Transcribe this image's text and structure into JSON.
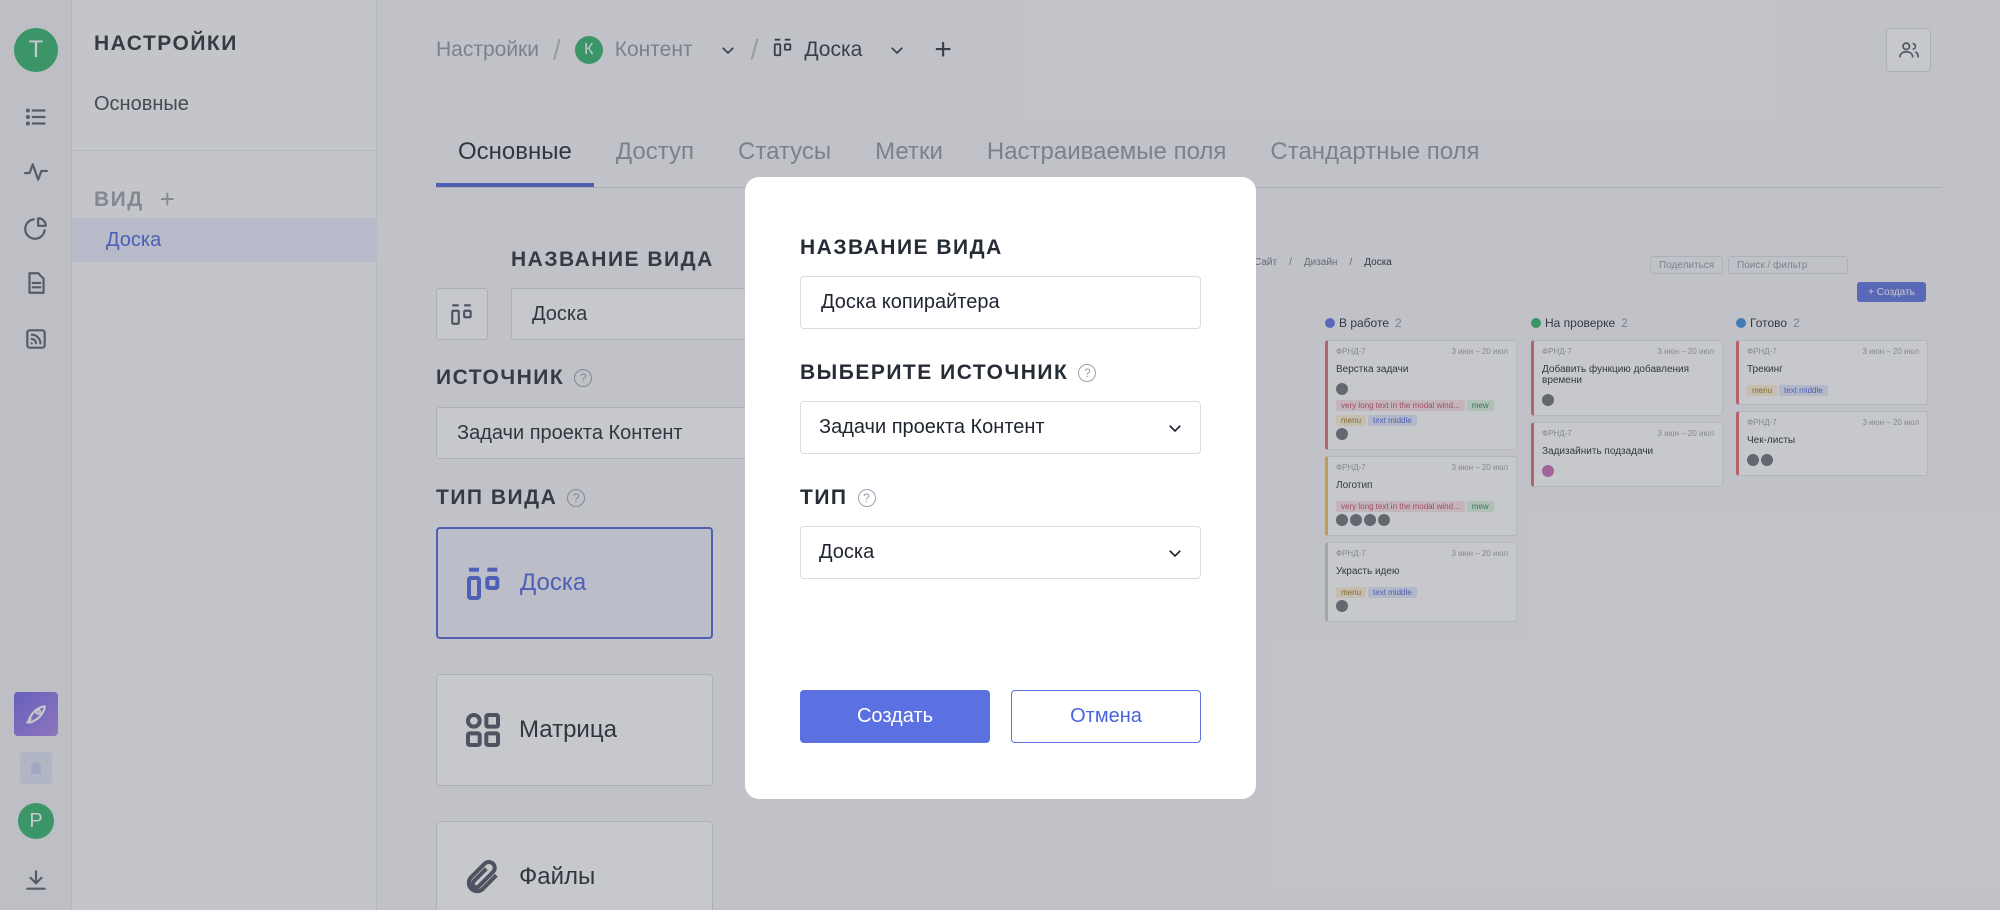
{
  "rail": {
    "user_initial": "T",
    "user_color": "#2fb36e",
    "bottom_initial": "P",
    "bottom_color": "#2fb36e",
    "icons": [
      "list-icon",
      "activity-icon",
      "pie-chart-icon",
      "document-icon",
      "feed-icon",
      "rocket-icon",
      "bell-icon",
      "download-icon"
    ]
  },
  "sidebar": {
    "title": "НАСТРОЙКИ",
    "main_item": "Основные",
    "section_title": "ВИД",
    "items": [
      {
        "label": "Доска"
      }
    ]
  },
  "breadcrumb": {
    "root": "Настройки",
    "project_initial": "К",
    "project": "Контент",
    "view": "Доска"
  },
  "tabs": [
    {
      "label": "Основные",
      "active": true
    },
    {
      "label": "Доступ"
    },
    {
      "label": "Статусы"
    },
    {
      "label": "Метки"
    },
    {
      "label": "Настраиваемые поля"
    },
    {
      "label": "Стандартные поля"
    }
  ],
  "form": {
    "name_label": "НАЗВАНИЕ ВИДА",
    "name_value": "Доска",
    "source_label": "ИСТОЧНИК",
    "source_value": "Задачи проекта Контент",
    "type_label": "ТИП ВИДА",
    "view_types": [
      {
        "label": "Доска",
        "selected": true
      },
      {
        "label": "Матрица"
      },
      {
        "label": "Файлы"
      }
    ]
  },
  "preview": {
    "crumbs": [
      "Сайт",
      "Дизайн",
      "Доска"
    ],
    "share": "Поделиться",
    "search_placeholder": "Поиск / фильтр",
    "create": "+ Создать",
    "columns": [
      {
        "title": "В работе",
        "count": "2",
        "color": "#5b71e1",
        "cards": [
          {
            "id": "ФРНД-7",
            "dates": "3 июн – 20 июл",
            "title": "Верстка задачи",
            "tags": [
              "very long text in the modal wind...",
              "mew",
              "menu",
              "text middle"
            ],
            "accent": "#e06a72"
          },
          {
            "id": "ФРНД-7",
            "dates": "3 июн – 20 июл",
            "title": "Логотип",
            "tags": [
              "very long text in the modal wind...",
              "mew"
            ],
            "accent": "#f0c240"
          },
          {
            "id": "ФРНД-7",
            "dates": "3 июн – 20 июл",
            "title": "Украсть идею",
            "tags": [
              "menu",
              "text middle"
            ],
            "accent": "#c9ccd2"
          }
        ]
      },
      {
        "title": "На проверке",
        "count": "2",
        "color": "#2fb36e",
        "cards": [
          {
            "id": "ФРНД-7",
            "dates": "3 июн – 20 июл",
            "title": "Добавить функцию добавления времени",
            "tags": [],
            "accent": "#e06a72"
          },
          {
            "id": "ФРНД-7",
            "dates": "3 июн – 20 июл",
            "title": "Задизайнить подзадачи",
            "tags": [],
            "accent": "#e06a72"
          }
        ]
      },
      {
        "title": "Готово",
        "count": "2",
        "color": "#3a8fe0",
        "cards": [
          {
            "id": "ФРНД-7",
            "dates": "3 июн – 20 июл",
            "title": "Трекинг",
            "tags": [
              "menu",
              "text middle"
            ],
            "accent": "#e06a72"
          },
          {
            "id": "ФРНД-7",
            "dates": "3 июн – 20 июл",
            "title": "Чек-листы",
            "tags": [],
            "accent": "#e06a72"
          }
        ]
      }
    ]
  },
  "modal": {
    "name_label": "НАЗВАНИЕ ВИДА",
    "name_value": "Доска копирайтера",
    "source_label": "ВЫБЕРИТЕ ИСТОЧНИК",
    "source_value": "Задачи проекта Контент",
    "type_label": "ТИП",
    "type_value": "Доска",
    "create_label": "Создать",
    "cancel_label": "Отмена"
  },
  "accent_color": "#5b71e1"
}
